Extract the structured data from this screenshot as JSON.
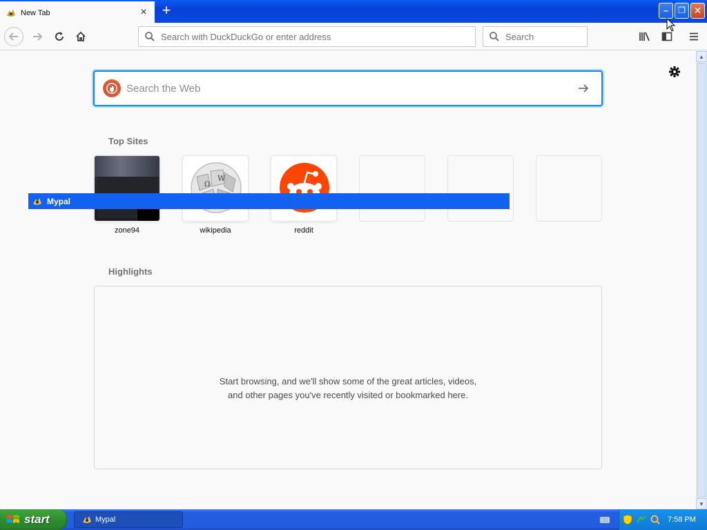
{
  "browser": {
    "tab": {
      "title": "New Tab",
      "close_glyph": "×"
    },
    "new_tab_glyph": "+",
    "window_controls": {
      "minimize": "–",
      "restore": "❐",
      "close": "✕"
    },
    "url_placeholder": "Search with DuckDuckGo or enter address",
    "search_placeholder": "Search"
  },
  "newtab": {
    "search_placeholder": "Search the Web",
    "top_sites_title": "Top Sites",
    "top_sites": [
      {
        "label": "zone94"
      },
      {
        "label": "wikipedia"
      },
      {
        "label": "reddit"
      },
      {
        "label": ""
      },
      {
        "label": ""
      },
      {
        "label": ""
      }
    ],
    "highlights_title": "Highlights",
    "highlights_message": "Start browsing, and we'll show some of the great articles, videos, and other pages you've recently visited or bookmarked here."
  },
  "overlay": {
    "title": "Mypal"
  },
  "taskbar": {
    "start_label": "start",
    "task_label": "Mypal",
    "clock": "7:58 PM"
  },
  "colors": {
    "accent": "#0a84ff",
    "xp_blue": "#245ee0",
    "reddit": "#ff4500",
    "duckduckgo": "#de5833"
  }
}
